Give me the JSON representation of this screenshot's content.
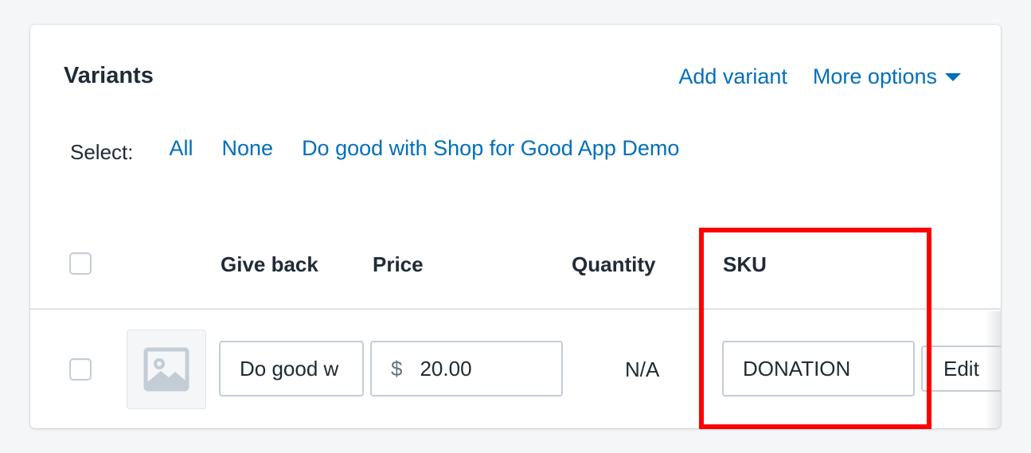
{
  "card": {
    "title": "Variants",
    "add_variant_label": "Add variant",
    "more_options_label": "More options"
  },
  "select": {
    "label": "Select:",
    "options": [
      "All",
      "None",
      "Do good with Shop for Good App Demo"
    ]
  },
  "table": {
    "columns": [
      "Give back",
      "Price",
      "Quantity",
      "SKU"
    ],
    "rows": [
      {
        "give_back": "Do good w",
        "currency_symbol": "$",
        "price": "20.00",
        "quantity": "N/A",
        "sku": "DONATION",
        "edit_label": "Edit"
      }
    ]
  },
  "colors": {
    "link": "#006fbb",
    "highlight": "#ff0000"
  },
  "icons": {
    "thumbnail": "image-placeholder-icon",
    "more_options": "caret-down-icon"
  }
}
